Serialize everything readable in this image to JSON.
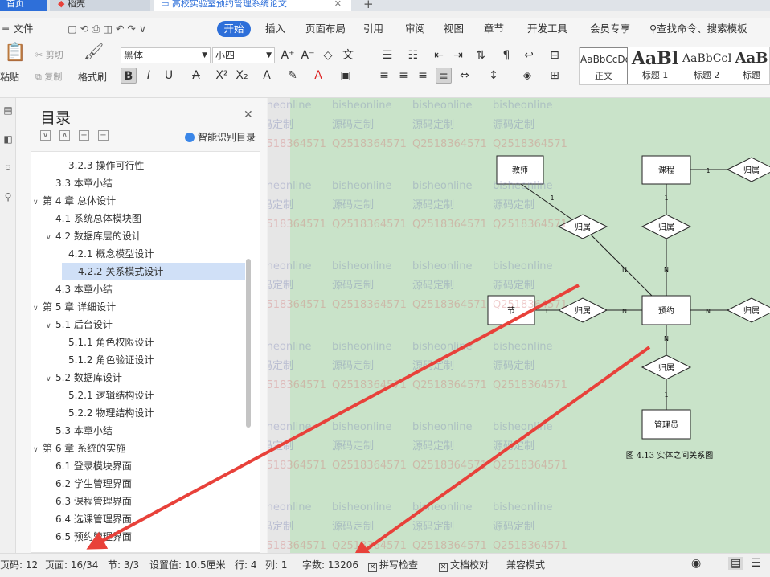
{
  "tabs": [
    {
      "label": "首页"
    },
    {
      "label": "稻壳"
    },
    {
      "label": "高校实验室预约管理系统论文"
    }
  ],
  "menu": [
    {
      "label": "≡ 文件"
    },
    {
      "label": "开始"
    },
    {
      "label": "插入"
    },
    {
      "label": "页面布局"
    },
    {
      "label": "引用"
    },
    {
      "label": "审阅"
    },
    {
      "label": "视图"
    },
    {
      "label": "章节"
    },
    {
      "label": "开发工具"
    },
    {
      "label": "会员专享"
    }
  ],
  "search": {
    "placeholder": "查找命令、搜索模板"
  },
  "ribbon": {
    "paste": "粘贴",
    "cut": "剪切",
    "copy": "复制",
    "format_painter": "格式刷",
    "font_name": "黑体",
    "font_size": "小四"
  },
  "styles": [
    {
      "preview": "AaBbCcDd",
      "name": "正文"
    },
    {
      "preview": "AaBl",
      "name": "标题 1"
    },
    {
      "preview": "AaBbCcI",
      "name": "标题 2"
    },
    {
      "preview": "AaB",
      "name": "标题"
    }
  ],
  "toc": {
    "title": "目录",
    "smart": "智能识别目录",
    "items": [
      {
        "text": "3.2.3  操作可行性",
        "level": 3,
        "arrow": ""
      },
      {
        "text": "3.3 本章小结",
        "level": 2,
        "arrow": ""
      },
      {
        "text": "第 4 章  总体设计",
        "level": 1,
        "arrow": "∨"
      },
      {
        "text": "4.1  系统总体模块图",
        "level": 2,
        "arrow": ""
      },
      {
        "text": "4.2  数据库层的设计",
        "level": 2,
        "arrow": "∨"
      },
      {
        "text": "4.2.1  概念模型设计",
        "level": 3,
        "arrow": ""
      },
      {
        "text": "4.2.2  关系模式设计",
        "level": 3,
        "arrow": "",
        "active": true
      },
      {
        "text": "4.3  本章小结",
        "level": 2,
        "arrow": ""
      },
      {
        "text": "第 5 章    详细设计",
        "level": 1,
        "arrow": "∨"
      },
      {
        "text": "5.1  后台设计",
        "level": 2,
        "arrow": "∨"
      },
      {
        "text": "5.1.1  角色权限设计",
        "level": 3,
        "arrow": ""
      },
      {
        "text": "5.1.2  角色验证设计",
        "level": 3,
        "arrow": ""
      },
      {
        "text": "5.2  数据库设计",
        "level": 2,
        "arrow": "∨"
      },
      {
        "text": "5.2.1  逻辑结构设计",
        "level": 3,
        "arrow": ""
      },
      {
        "text": "5.2.2  物理结构设计",
        "level": 3,
        "arrow": ""
      },
      {
        "text": "5.3  本章小结",
        "level": 2,
        "arrow": ""
      },
      {
        "text": "第 6 章  系统的实施",
        "level": 1,
        "arrow": "∨"
      },
      {
        "text": "6.1  登录模块界面",
        "level": 2,
        "arrow": ""
      },
      {
        "text": "6.2  学生管理界面",
        "level": 2,
        "arrow": ""
      },
      {
        "text": "6.3    课程管理界面",
        "level": 2,
        "arrow": ""
      },
      {
        "text": "6.4  选课管理界面",
        "level": 2,
        "arrow": ""
      },
      {
        "text": "6.5  预约管理界面",
        "level": 2,
        "arrow": ""
      }
    ]
  },
  "ruler": [
    "6",
    "4",
    "2",
    "2",
    "4",
    "6",
    "8",
    "10",
    "12",
    "14",
    "16",
    "18",
    "20",
    "22",
    "24",
    "26",
    "28",
    "30"
  ],
  "diagram": {
    "entities": {
      "teacher": "教师",
      "course": "课程",
      "section": "节",
      "booking": "预约",
      "admin": "管理员"
    },
    "rel": "归属",
    "card_one": "1",
    "card_n": "N",
    "caption": "图 4.13  实体之间关系图"
  },
  "watermarks": {
    "a": "bisheonline",
    "b": "源码定制",
    "c": "Q2518364571"
  },
  "status": {
    "page_num": "页码: 12",
    "pages": "页面: 16/34",
    "section": "节: 3/3",
    "setting": "设置值: 10.5厘米",
    "row": "行: 4",
    "col": "列: 1",
    "words": "字数: 13206",
    "spell": "拼写检查",
    "proof": "文档校对",
    "compat": "兼容模式"
  },
  "colors": {
    "accent": "#2e6fd9",
    "page_bg": "#c9e3c9",
    "arrow": "#e8413a"
  }
}
